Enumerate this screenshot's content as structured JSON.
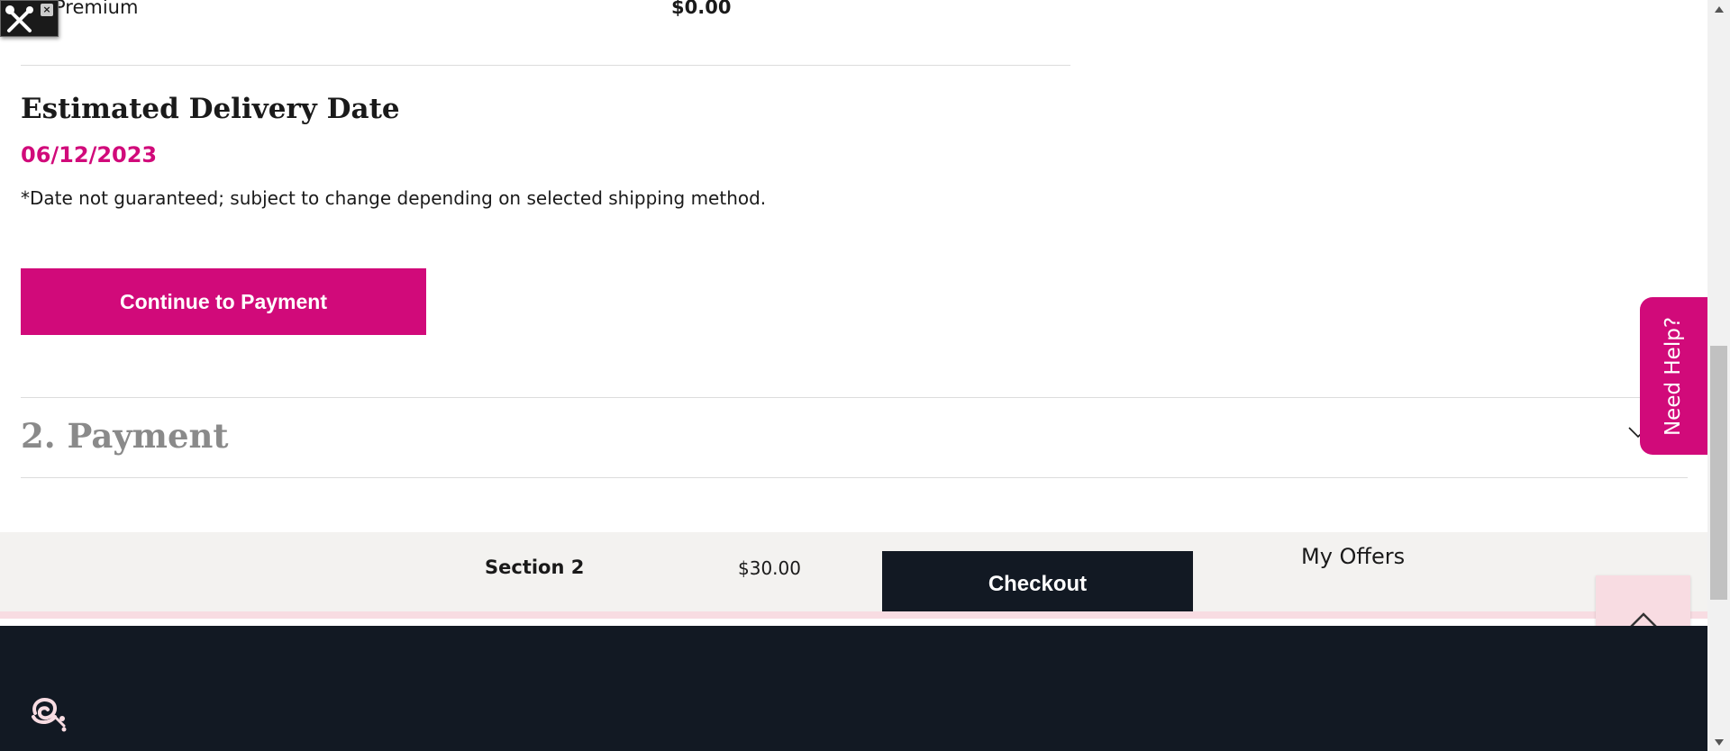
{
  "tools_widget": {
    "close_label": "×"
  },
  "premium": {
    "label": "Premium",
    "value": "$0.00"
  },
  "delivery": {
    "title": "Estimated Delivery Date",
    "date": "06/12/2023",
    "note": "*Date not guaranteed; subject to change depending on selected shipping method."
  },
  "continue_button": {
    "label": "Continue to Payment"
  },
  "payment_section": {
    "title": "2. Payment"
  },
  "need_help": {
    "label": "Need Help?"
  },
  "checkout_bar": {
    "section_label": "Section 2",
    "price": "$30.00",
    "checkout_label": "Checkout",
    "offers_label": "My Offers"
  },
  "colors": {
    "brand_pink": "#d10a7a",
    "dark_navy": "#121923",
    "light_pink": "#f8dce2",
    "bar_gray": "#f3f2f0"
  },
  "icons": [
    "tools-icon",
    "close-icon",
    "chevron-down-icon",
    "chevron-up-icon",
    "rose-logo-icon",
    "scroll-up-arrow-icon",
    "scroll-down-arrow-icon"
  ]
}
